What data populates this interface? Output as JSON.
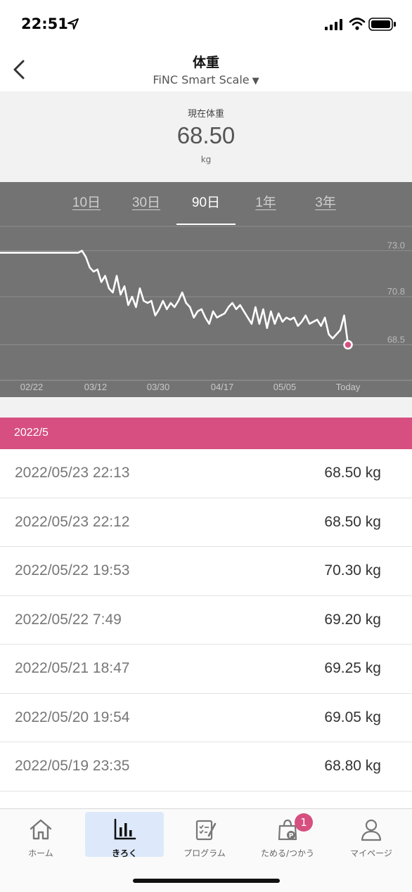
{
  "status_bar": {
    "time": "22:51"
  },
  "header": {
    "title": "体重",
    "device": "FiNC Smart Scale",
    "device_caret": "▼"
  },
  "current": {
    "label": "現在体重",
    "value": "68.50",
    "unit": "kg"
  },
  "chart": {
    "tabs": [
      {
        "label": "10日"
      },
      {
        "label": "30日"
      },
      {
        "label": "90日"
      },
      {
        "label": "1年"
      },
      {
        "label": "3年"
      }
    ],
    "active_tab": "90日"
  },
  "chart_data": {
    "type": "line",
    "title": "",
    "xlabel": "",
    "ylabel": "",
    "x_tick_labels": [
      "02/22",
      "03/12",
      "03/30",
      "04/17",
      "05/05",
      "Today"
    ],
    "y_tick_labels": [
      "73.0",
      "70.8",
      "68.5"
    ],
    "ylim": [
      66.8,
      74.2
    ],
    "grid": true,
    "series": [
      {
        "values": [
          72.9,
          72.9,
          72.9,
          72.9,
          72.9,
          72.9,
          72.9,
          72.9,
          72.9,
          72.9,
          72.9,
          72.9,
          72.9,
          72.9,
          72.9,
          72.9,
          72.9,
          72.9,
          72.9,
          72.9,
          72.9,
          72.9,
          73.0,
          72.7,
          72.2,
          72.0,
          72.1,
          71.5,
          71.8,
          71.2,
          71.0,
          71.8,
          70.9,
          71.3,
          70.4,
          70.8,
          70.3,
          71.2,
          70.6,
          70.5,
          70.6,
          69.9,
          70.2,
          70.6,
          70.2,
          70.5,
          70.3,
          70.6,
          71.0,
          70.5,
          70.3,
          69.8,
          70.1,
          70.2,
          69.8,
          69.5,
          70.1,
          69.8,
          69.9,
          70.0,
          70.3,
          70.5,
          70.2,
          70.4,
          70.1,
          69.8,
          69.5,
          70.3,
          69.5,
          70.2,
          69.3,
          70.1,
          69.5,
          70.0,
          69.6,
          69.8,
          69.7,
          69.8,
          69.4,
          69.6,
          69.9,
          69.5,
          69.6,
          69.7,
          69.4,
          69.8,
          69.0,
          68.8,
          69.0,
          69.2,
          69.9,
          68.5
        ]
      }
    ],
    "x_range": [
      "02/16",
      "05/23"
    ],
    "marker_last_point": true
  },
  "month_header": "2022/5",
  "records": [
    {
      "datetime": "2022/05/23 22:13",
      "value": "68.50 kg"
    },
    {
      "datetime": "2022/05/23 22:12",
      "value": "68.50 kg"
    },
    {
      "datetime": "2022/05/22 19:53",
      "value": "70.30 kg"
    },
    {
      "datetime": "2022/05/22 7:49",
      "value": "69.20 kg"
    },
    {
      "datetime": "2022/05/21 18:47",
      "value": "69.25 kg"
    },
    {
      "datetime": "2022/05/20 19:54",
      "value": "69.05 kg"
    },
    {
      "datetime": "2022/05/19 23:35",
      "value": "68.80 kg"
    }
  ],
  "tab_bar": {
    "items": [
      {
        "label": "ホーム",
        "icon": "home-icon"
      },
      {
        "label": "きろく",
        "icon": "bar-chart-icon"
      },
      {
        "label": "プログラム",
        "icon": "clipboard-icon"
      },
      {
        "label": "ためる/つかう",
        "icon": "points-bag-icon",
        "badge": "1"
      },
      {
        "label": "マイページ",
        "icon": "person-icon"
      }
    ],
    "active": "きろく"
  },
  "colors": {
    "accent": "#d64f80",
    "chart_bg": "#737373",
    "active_tab_bg": "#dde9fa"
  }
}
